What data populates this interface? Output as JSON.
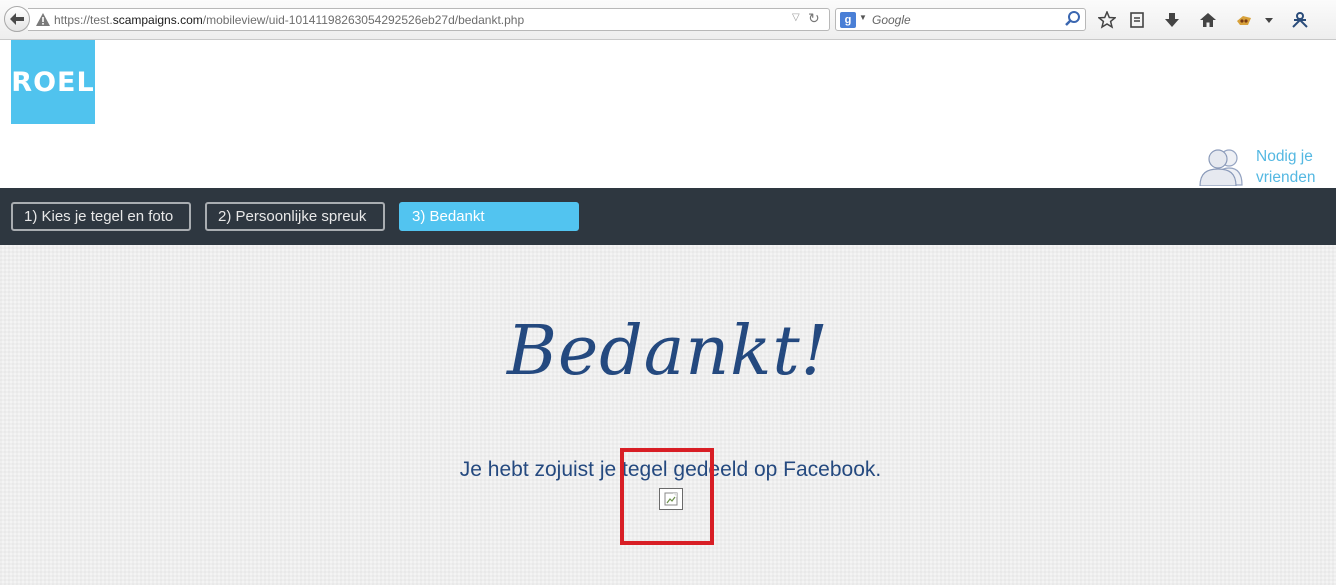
{
  "browser": {
    "url_prefix": "https://test.",
    "url_domain": "scampaigns.com",
    "url_path": "/mobileview/uid-10141198263054292526eb27d/bedankt.php",
    "search_placeholder": "Google",
    "search_engine_letter": "g"
  },
  "site": {
    "logo_text": "ROEL",
    "invite_line1": "Nodig je",
    "invite_line2": "vrienden uit"
  },
  "steps": [
    {
      "label": "1) Kies je tegel en foto",
      "active": false
    },
    {
      "label": "2) Persoonlijke spreuk",
      "active": false
    },
    {
      "label": "3) Bedankt",
      "active": true
    }
  ],
  "main": {
    "heading": "Bedankt!",
    "message": "Je hebt zojuist je tegel gedeeld op Facebook."
  },
  "colors": {
    "accent": "#52c4f0",
    "nav_bg": "#2e3740",
    "heading": "#24497f",
    "highlight": "#d81e25"
  }
}
